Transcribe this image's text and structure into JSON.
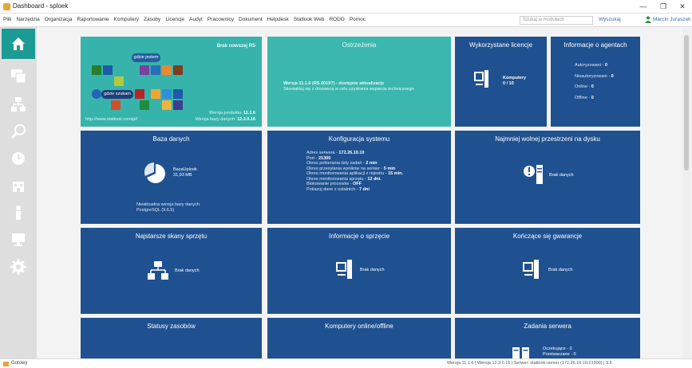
{
  "window": {
    "title": "Dashboard - sploek",
    "minimize": "—",
    "maximize": "❐",
    "close": "✕"
  },
  "menu": [
    "Plik",
    "Narzędzia",
    "Organizacja",
    "Raportowanie",
    "Komputery",
    "Zasoby",
    "Licencje",
    "Audyt",
    "Pracownicy",
    "Dokument",
    "Helpdesk",
    "Statlook Web",
    "RODO",
    "Pomoc"
  ],
  "search": {
    "placeholder": "Szukaj w modułach",
    "button": "Wyszukaj"
  },
  "user": {
    "name": "Marcin Juraszek"
  },
  "sidebar": {
    "items": [
      {
        "icon": "home-icon",
        "active": true
      },
      {
        "icon": "computers-icon"
      },
      {
        "icon": "network-icon"
      },
      {
        "icon": "search-icon"
      },
      {
        "icon": "clock-icon"
      },
      {
        "icon": "building-icon"
      },
      {
        "icon": "user-icon"
      },
      {
        "icon": "monitor-icon"
      },
      {
        "icon": "settings-icon"
      }
    ]
  },
  "tiles": {
    "promo": {
      "title": "Brak nowszej RS",
      "bubble1": "gdzie jestem",
      "bubble2": "gdzie szukam",
      "url": "http://www.statlook.com/pl/",
      "version_label": "Wersja produktu:",
      "version_value": "11.1.6",
      "db_label": "Wersja bazy danych:",
      "db_value": "12.3.0.16"
    },
    "warnings": {
      "title": "Ostrzeżenia",
      "line1": "Wersja 11.1.6 (RS 2019?) - dostępne aktualizacje",
      "line2": "Skontaktuj się z dostawcą w celu uzyskania wsparcia technicznego"
    },
    "licenses": {
      "title": "Wykorzystane licencje",
      "label": "Komputery",
      "value": "0 / 10"
    },
    "agents": {
      "title": "Informacje o agentach",
      "rows": [
        {
          "label": "Autoryzowani",
          "value": "0"
        },
        {
          "label": "Nieautoryzowani",
          "value": "0"
        },
        {
          "label": "Online",
          "value": "0"
        },
        {
          "label": "Offline",
          "value": "0"
        }
      ]
    },
    "database": {
      "title": "Baza danych",
      "name": "BazaUplook",
      "size": "31,93 MB",
      "note1": "Nieaktualna wersja bazy danych",
      "note2": "PostgreSQL (9.6.5)"
    },
    "config": {
      "title": "Konfiguracja systemu",
      "rows": [
        {
          "label": "Adres serwera",
          "value": "172.26.10.10"
        },
        {
          "label": "Port",
          "value": "21300"
        },
        {
          "label": "Okres pobierania listy zadań",
          "value": "2 min"
        },
        {
          "label": "Okres przesyłania wyników na serwer",
          "value": "5 min"
        },
        {
          "label": "Okres monitorowania aplikacji z rejestru",
          "value": "15 min."
        },
        {
          "label": "Okres monitorowania sprzętu",
          "value": "12 dni."
        },
        {
          "label": "Blokowanie procesów",
          "value": "OFF"
        },
        {
          "label": "Pokazuj dane z ostatnich",
          "value": "7 dni"
        }
      ]
    },
    "disk": {
      "title": "Najmniej wolnej przestrzeni na dysku",
      "empty": "Brak danych"
    },
    "oldest": {
      "title": "Najstarsze skany sprzętu",
      "empty": "Brak danych"
    },
    "hardware": {
      "title": "Informacje o sprzęcie",
      "empty": "Brak danych"
    },
    "warranty": {
      "title": "Kończące się gwarancje",
      "empty": "Brak danych"
    },
    "assets": {
      "title": "Statusy zasobów"
    },
    "online": {
      "title": "Komputery online/offline"
    },
    "tasks": {
      "title": "Zadania serwera",
      "row1": "Oczekujące - 0",
      "row2": "Przetwarzane - 0"
    }
  },
  "status": {
    "left": "Gotowy",
    "right": "Wersja 11.1.6  |  Wersja 12.3.0.16  |  Serwer: statlook-server (172.26.10.10:21300)  |  9.6"
  },
  "colors": {
    "tile": "#1f5190",
    "teal": "#36b3ab",
    "active_nav": "#1c9b95"
  }
}
